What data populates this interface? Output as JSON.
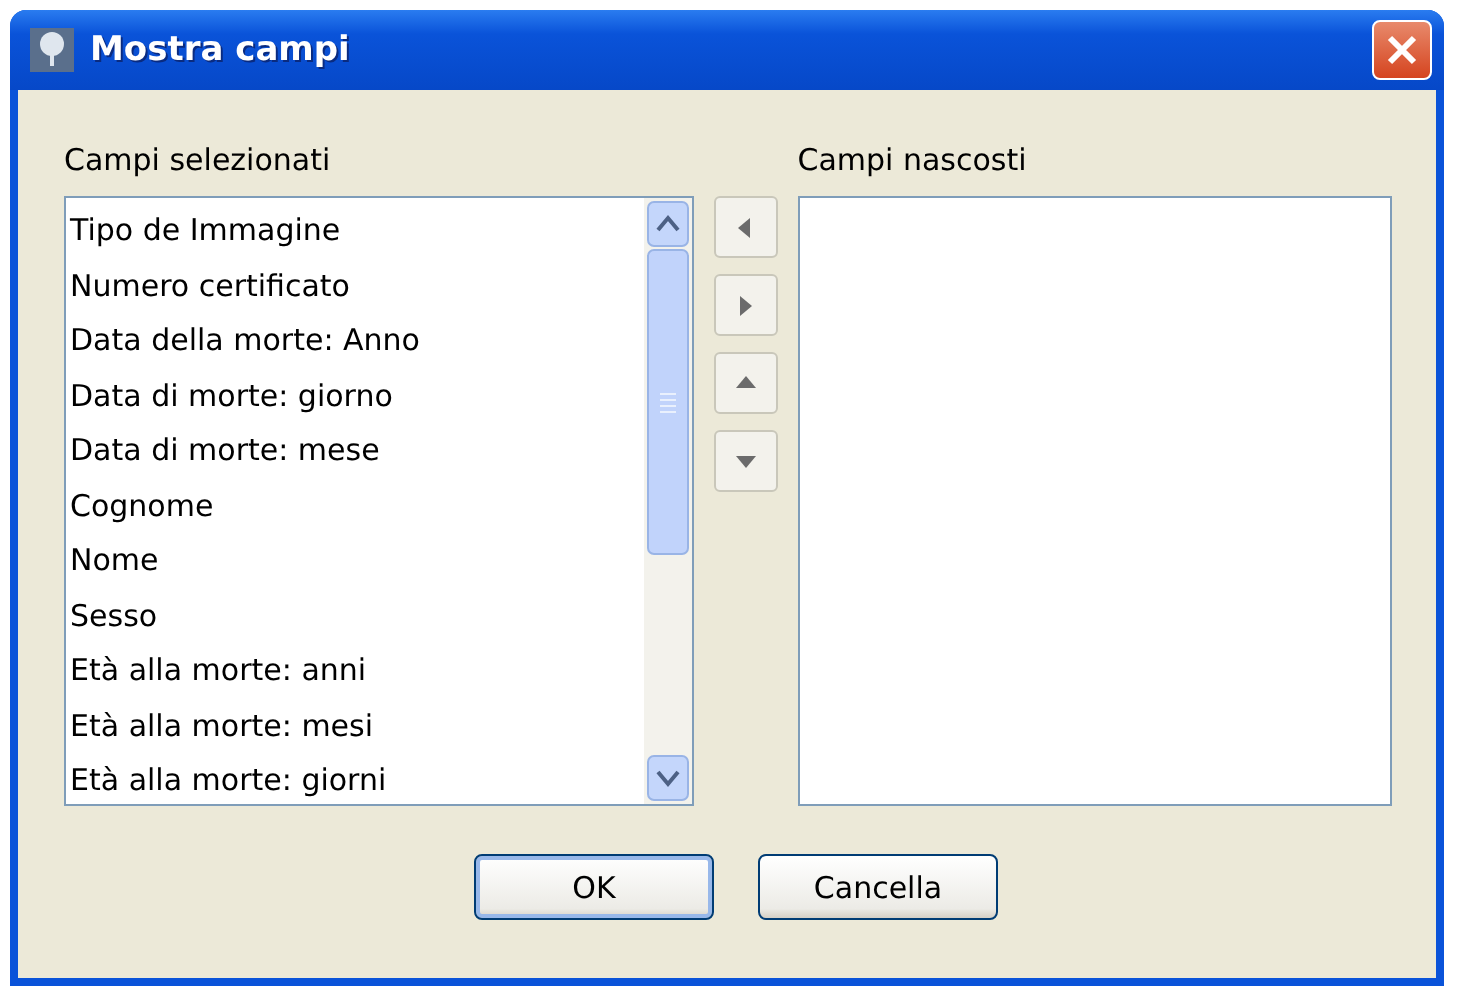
{
  "window": {
    "title": "Mostra campi"
  },
  "selected_fields": {
    "label": "Campi selezionati",
    "items": [
      "Tipo de Immagine",
      "Numero certificato",
      "Data della morte: Anno",
      "Data di morte: giorno",
      "Data di morte: mese",
      "Cognome",
      "Nome",
      "Sesso",
      "Età alla morte: anni",
      "Età alla morte: mesi",
      "Età alla morte: giorni"
    ]
  },
  "move_buttons": [
    {
      "kind": "left"
    },
    {
      "kind": "right"
    },
    {
      "kind": "up"
    },
    {
      "kind": "down"
    }
  ],
  "hidden_fields": {
    "label": "Campi nascosti"
  },
  "buttons": [
    {
      "label": "OK",
      "default": true
    },
    {
      "label": "Cancella",
      "default": false
    }
  ]
}
